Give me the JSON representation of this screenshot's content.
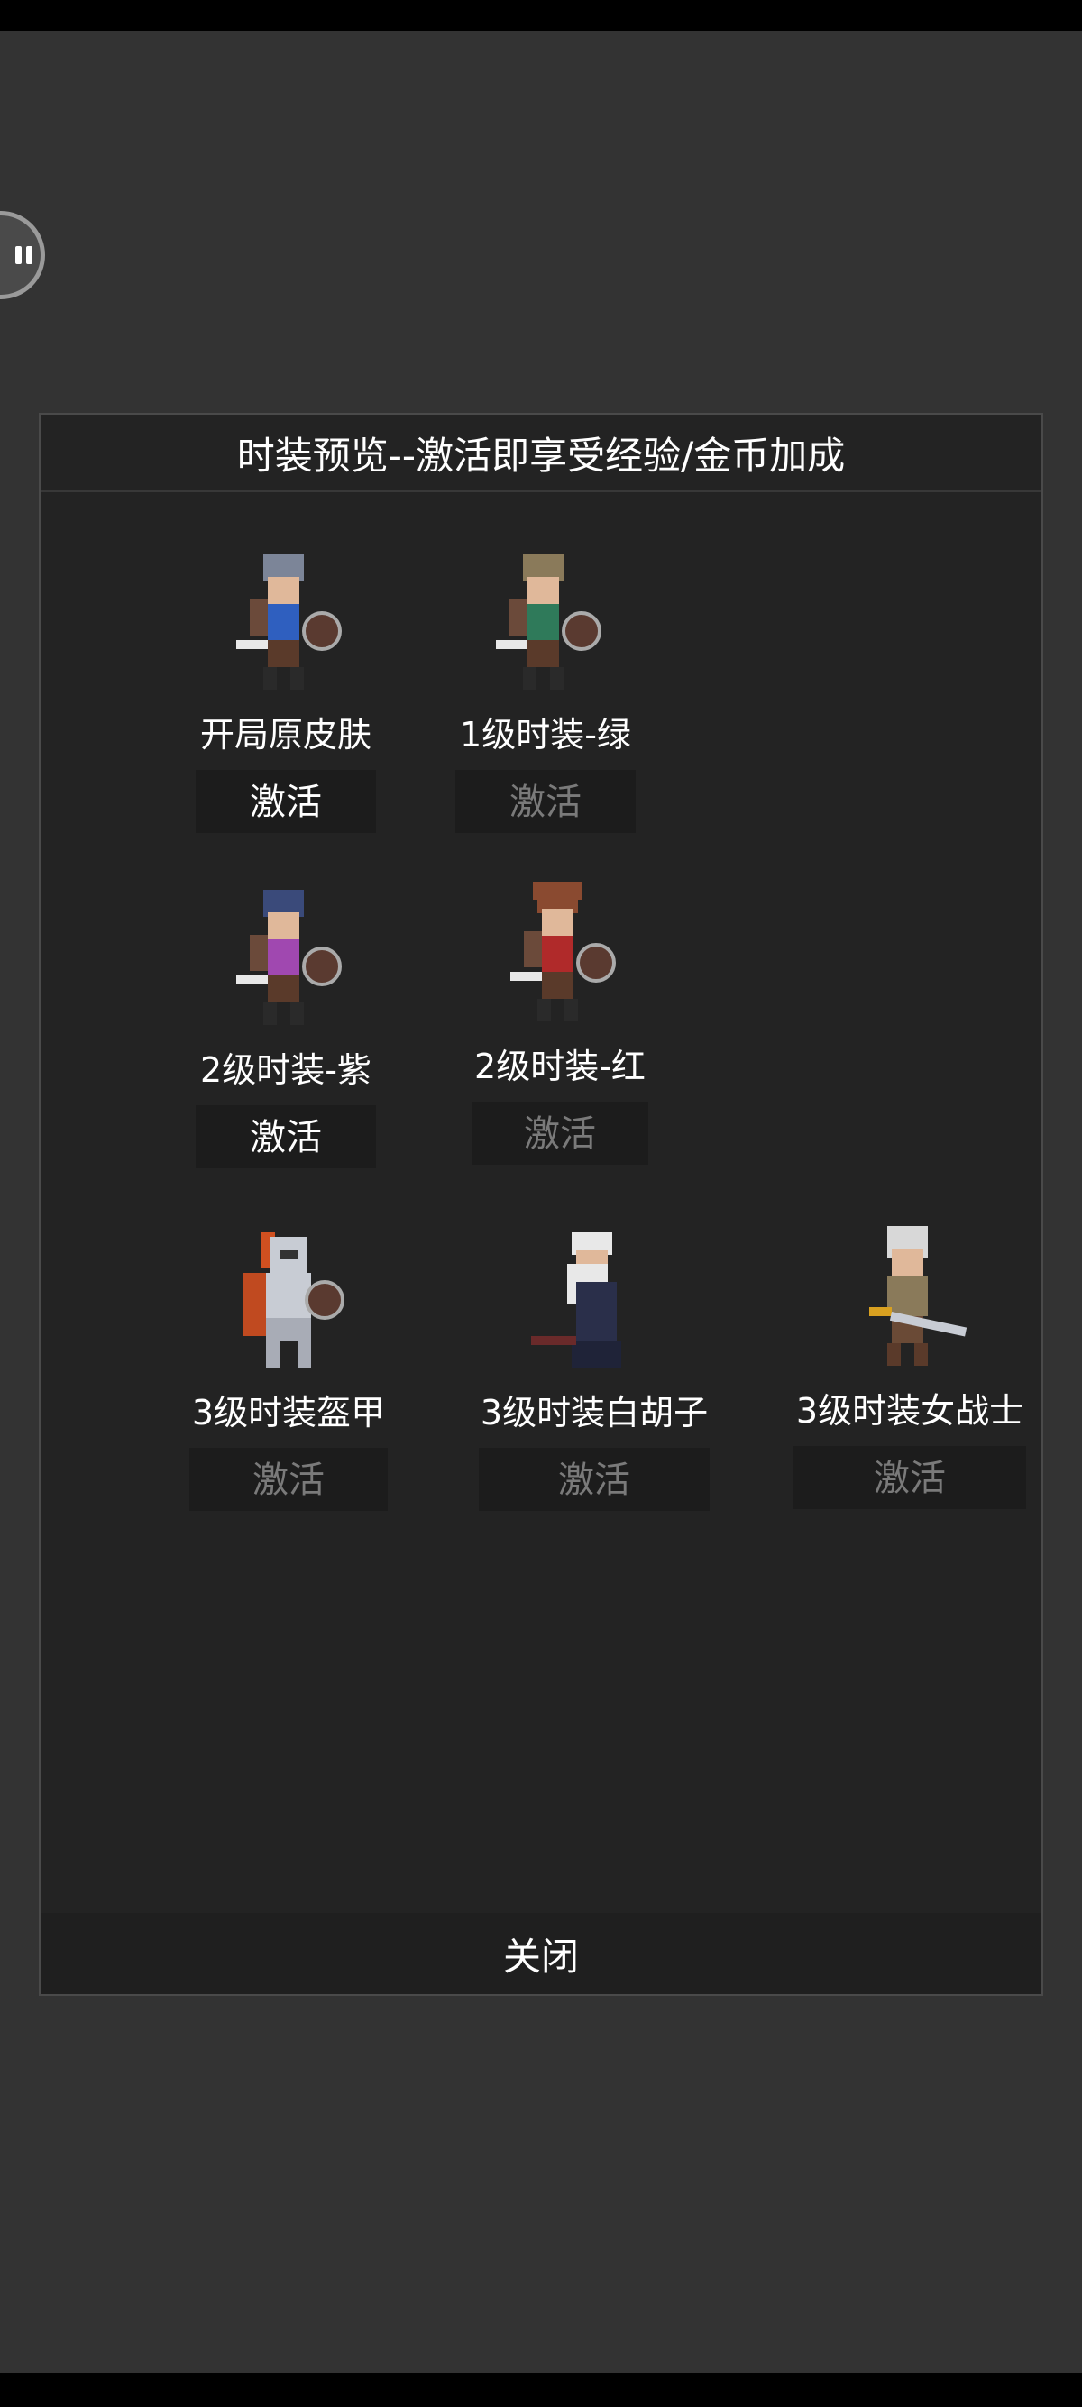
{
  "dialog": {
    "title": "时装预览--激活即享受经验/金币加成",
    "close_label": "关闭"
  },
  "skins": [
    {
      "name": "开局原皮肤",
      "button": "激活",
      "enabled": true,
      "hair": "#7c8598",
      "shirt": "#2f5fbf"
    },
    {
      "name": "1级时装-绿",
      "button": "激活",
      "enabled": false,
      "hair": "#8a7a5a",
      "shirt": "#2f7a5a"
    },
    {
      "name": "2级时装-紫",
      "button": "激活",
      "enabled": true,
      "hair": "#3a4a7a",
      "shirt": "#a048b0"
    },
    {
      "name": "2级时装-红",
      "button": "激活",
      "enabled": false,
      "hair": "#8a4a30",
      "shirt": "#b02a2a"
    },
    {
      "name": "3级时装盔甲",
      "button": "激活",
      "enabled": false,
      "hair": "#d05020",
      "shirt": "#c8ccd4"
    },
    {
      "name": "3级时装白胡子",
      "button": "激活",
      "enabled": false,
      "hair": "#e8e8e8",
      "shirt": "#2a2f4a"
    },
    {
      "name": "3级时装女战士",
      "button": "激活",
      "enabled": false,
      "hair": "#d8d8d8",
      "shirt": "#8a7a5a"
    }
  ]
}
